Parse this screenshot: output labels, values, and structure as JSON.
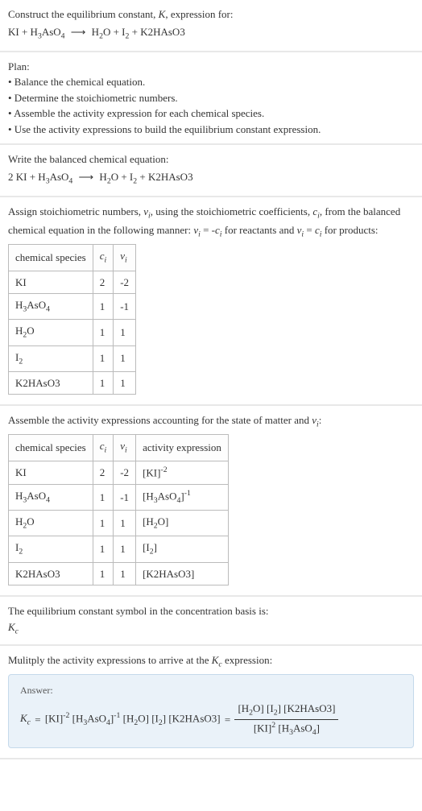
{
  "intro": {
    "line1": "Construct the equilibrium constant, K, expression for:",
    "equation_text": "KI + H₃AsO₄ ⟶ H₂O + I₂ + K2HAsO3"
  },
  "plan": {
    "heading": "Plan:",
    "b1": "• Balance the chemical equation.",
    "b2": "• Determine the stoichiometric numbers.",
    "b3": "• Assemble the activity expression for each chemical species.",
    "b4": "• Use the activity expressions to build the equilibrium constant expression."
  },
  "balanced": {
    "heading": "Write the balanced chemical equation:",
    "equation_text": "2 KI + H₃AsO₄ ⟶ H₂O + I₂ + K2HAsO3"
  },
  "stoich": {
    "para_a": "Assign stoichiometric numbers, νᵢ, using the stoichiometric coefficients, cᵢ, from the balanced chemical equation in the following manner: νᵢ = -cᵢ for reactants and νᵢ = cᵢ for products:",
    "h_species": "chemical species",
    "h_c": "cᵢ",
    "h_v": "νᵢ",
    "rows": [
      {
        "sp": "KI",
        "c": "2",
        "v": "-2"
      },
      {
        "sp": "H₃AsO₄",
        "c": "1",
        "v": "-1"
      },
      {
        "sp": "H₂O",
        "c": "1",
        "v": "1"
      },
      {
        "sp": "I₂",
        "c": "1",
        "v": "1"
      },
      {
        "sp": "K2HAsO3",
        "c": "1",
        "v": "1"
      }
    ]
  },
  "activity": {
    "para": "Assemble the activity expressions accounting for the state of matter and νᵢ:",
    "h_species": "chemical species",
    "h_c": "cᵢ",
    "h_v": "νᵢ",
    "h_expr": "activity expression",
    "rows": [
      {
        "sp": "KI",
        "c": "2",
        "v": "-2",
        "expr": "[KI]⁻²"
      },
      {
        "sp": "H₃AsO₄",
        "c": "1",
        "v": "-1",
        "expr": "[H₃AsO₄]⁻¹"
      },
      {
        "sp": "H₂O",
        "c": "1",
        "v": "1",
        "expr": "[H₂O]"
      },
      {
        "sp": "I₂",
        "c": "1",
        "v": "1",
        "expr": "[I₂]"
      },
      {
        "sp": "K2HAsO3",
        "c": "1",
        "v": "1",
        "expr": "[K2HAsO3]"
      }
    ]
  },
  "kc_symbol": {
    "para": "The equilibrium constant symbol in the concentration basis is:",
    "sym": "K_c"
  },
  "multiply": {
    "para": "Mulitply the activity expressions to arrive at the K_c expression:"
  },
  "answer": {
    "label": "Answer:",
    "kc": "K_c",
    "eq": " = ",
    "lhs": "[KI]⁻² [H₃AsO₄]⁻¹ [H₂O] [I₂] [K2HAsO3]",
    "num": "[H₂O] [I₂] [K2HAsO3]",
    "den": "[KI]² [H₃AsO₄]"
  }
}
